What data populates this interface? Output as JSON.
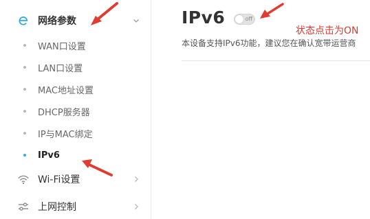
{
  "sidebar": {
    "network_section": {
      "label": "网络参数",
      "icon": "network-e-icon",
      "expanded": true
    },
    "items": [
      {
        "label": "WAN口设置",
        "active": false
      },
      {
        "label": "LAN口设置",
        "active": false
      },
      {
        "label": "MAC地址设置",
        "active": false
      },
      {
        "label": "DHCP服务器",
        "active": false
      },
      {
        "label": "IP与MAC绑定",
        "active": false
      },
      {
        "label": "IPv6",
        "active": true
      }
    ],
    "wifi_section": {
      "label": "Wi-Fi设置",
      "icon": "wifi-icon"
    },
    "access_section": {
      "label": "上网控制",
      "icon": "sliders-icon"
    }
  },
  "main": {
    "title": "IPv6",
    "toggle": {
      "state_label": "off",
      "on": false
    },
    "description": "本设备支持IPv6功能，建议您在确认宽带运营商"
  },
  "annotation": {
    "text": "状态点击为ON"
  },
  "colors": {
    "accent": "#33aadd",
    "annotation_red": "#d63a2f",
    "arrow_red": "#e03c31"
  }
}
